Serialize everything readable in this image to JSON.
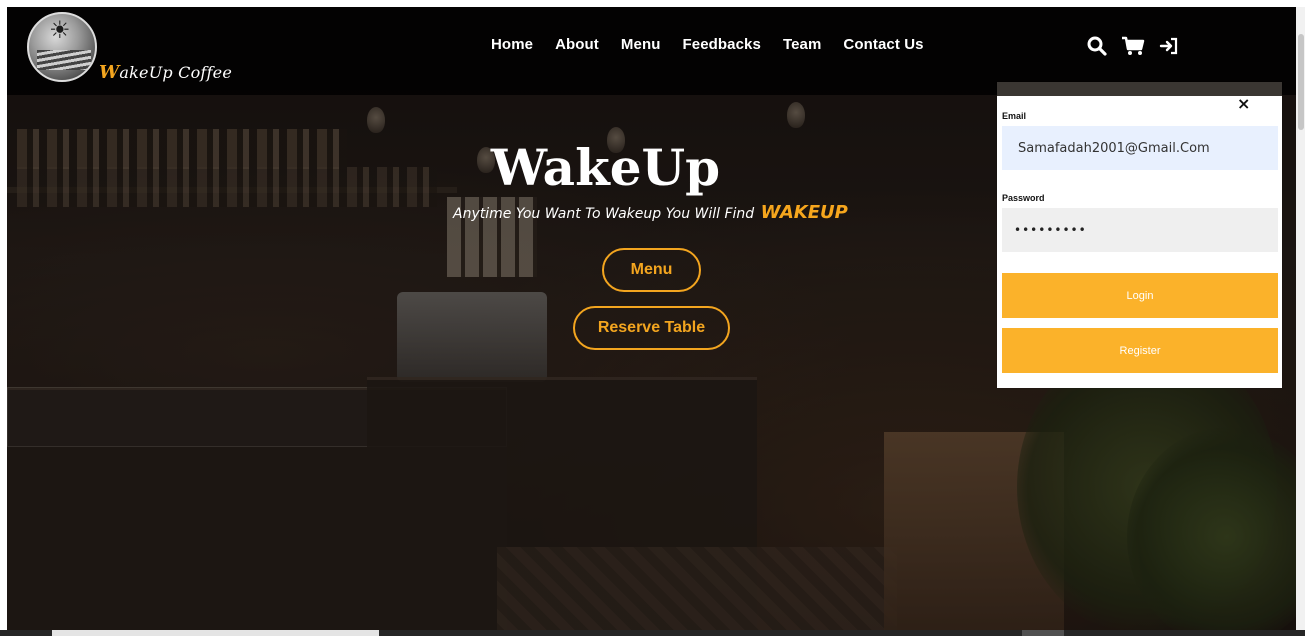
{
  "header": {
    "brand_first": "W",
    "brand_rest": "akeUp Coffee",
    "nav": [
      "Home",
      "About",
      "Menu",
      "Feedbacks",
      "Team",
      "Contact Us"
    ],
    "icons": [
      "search-icon",
      "cart-icon",
      "login-icon"
    ]
  },
  "hero": {
    "title": "WakeUp",
    "tagline": "Anytime You Want To Wakeup You Will Find",
    "tagline_accent": "WAKEUP",
    "menu_button": "Menu",
    "reserve_button": "Reserve Table"
  },
  "login": {
    "close": "×",
    "email_label": "Email",
    "email_value": "Samafadah2001@Gmail.Com",
    "password_label": "Password",
    "password_value": "•••••••••",
    "login_button": "Login",
    "register_button": "Register"
  },
  "colors": {
    "accent": "#f3a51f",
    "button_fill": "#fbb22a",
    "email_bg": "#e8f0fe",
    "header_bg": "#000000"
  }
}
